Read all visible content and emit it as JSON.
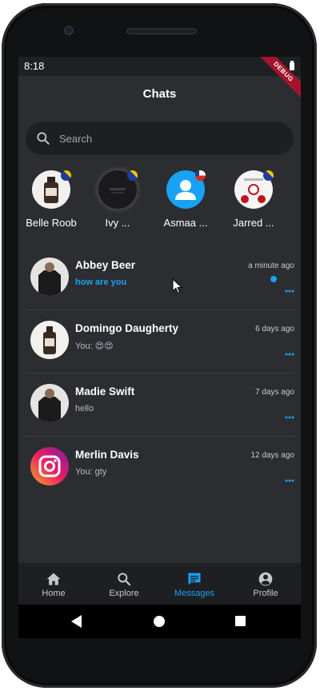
{
  "status_bar": {
    "time": "8:18"
  },
  "debug_banner": "DEBUG",
  "header": {
    "title": "Chats"
  },
  "search": {
    "placeholder": "Search"
  },
  "stories": [
    {
      "name": "Belle Roob"
    },
    {
      "name": "Ivy ..."
    },
    {
      "name": "Asmaa ..."
    },
    {
      "name": "Jarred ..."
    }
  ],
  "chats": [
    {
      "name": "Abbey Beer",
      "message": "how are you",
      "time": "a minute ago",
      "unread": true
    },
    {
      "name": "Domingo Daugherty",
      "message": "You: 😍😍",
      "time": "6 days ago",
      "unread": false
    },
    {
      "name": "Madie Swift",
      "message": "hello",
      "time": "7 days ago",
      "unread": false
    },
    {
      "name": "Merlin Davis",
      "message": "You: gty",
      "time": "12 days ago",
      "unread": false
    }
  ],
  "bottom_nav": {
    "active": "Messages",
    "items": [
      {
        "label": "Home",
        "icon": "home-icon"
      },
      {
        "label": "Explore",
        "icon": "search-icon"
      },
      {
        "label": "Messages",
        "icon": "message-icon"
      },
      {
        "label": "Profile",
        "icon": "account-circle-icon"
      }
    ]
  },
  "colors": {
    "accent": "#19a2f4",
    "background": "#2c2d31",
    "surface": "#1e1f22",
    "debug": "#a3142a"
  }
}
